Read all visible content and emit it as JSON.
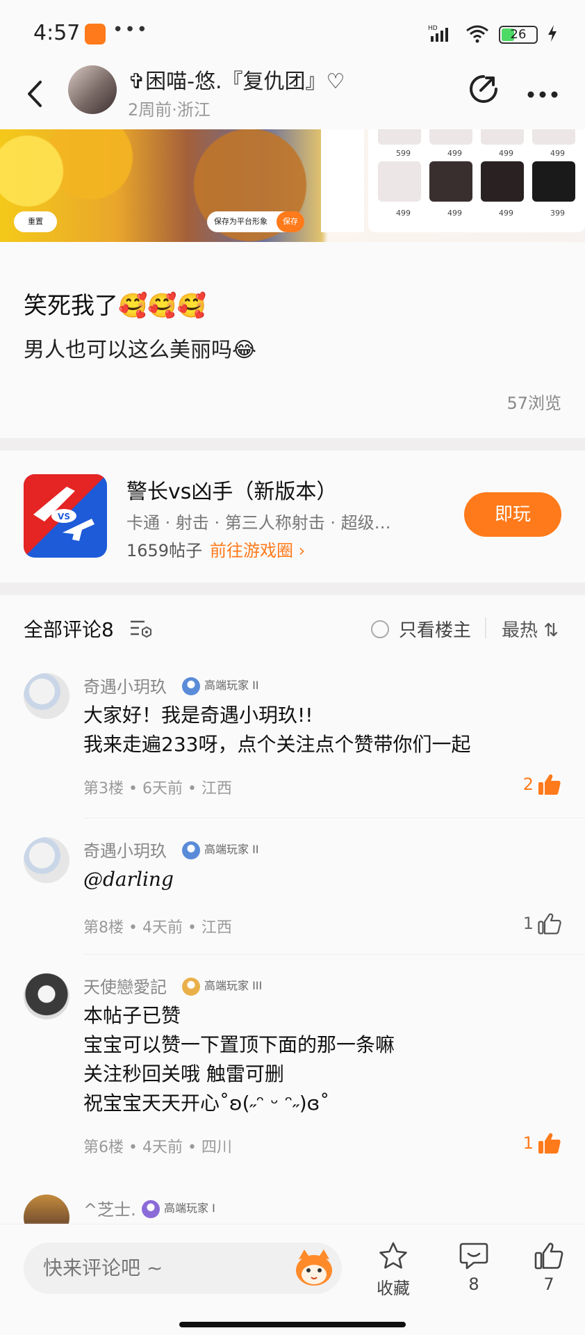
{
  "status": {
    "time": "4:57",
    "dots": "•••",
    "network": "HD",
    "battery": "26"
  },
  "header": {
    "author_name": "✞困喵-悠.『复仇团』♡",
    "meta": "2周前·浙江"
  },
  "image_panel": {
    "prices": [
      "599",
      "499",
      "499",
      "499",
      "499",
      "499",
      "499",
      "399"
    ],
    "reset_label": "重置",
    "save_label": "保存为平台形象",
    "save_btn": "保存"
  },
  "post": {
    "title": "笑死我了🥰🥰🥰",
    "body": "男人也可以这么美丽吗😂",
    "views": "57浏览"
  },
  "game": {
    "name": "警长vs凶手（新版本）",
    "tags": "卡通 · 射击 · 第三人称射击 · 超级…",
    "posts": "1659帖子",
    "link": "前往游戏圈 ›",
    "play": "即玩"
  },
  "comments_header": {
    "title": "全部评论8",
    "only_op": "只看楼主",
    "sort": "最热 ⇅"
  },
  "comments": [
    {
      "name": "奇遇小玥玖",
      "badge": "高端玩家 II",
      "lines": [
        "大家好！我是奇遇小玥玖!!",
        "我来走遍233呀，点个关注点个赞带你们一起"
      ],
      "meta": "第3楼 • 6天前 • 江西",
      "likes": "2",
      "liked": true
    },
    {
      "name": "奇遇小玥玖",
      "badge": "高端玩家 II",
      "lines": [
        "@darling"
      ],
      "meta": "第8楼 • 4天前 • 江西",
      "likes": "1",
      "liked": false
    },
    {
      "name": "天使戀愛記",
      "badge": "高端玩家 III",
      "lines": [
        "本帖子已赞",
        "宝宝可以赞一下置顶下面的那一条嘛",
        "关注秒回关哦 触雷可删",
        "祝宝宝天天开心˚ʚ(˶ᵔ ᵕ ᵔ˶)ɞ˚"
      ],
      "meta": "第6楼 • 4天前 • 四川",
      "likes": "1",
      "liked": true
    },
    {
      "name": "^芝士.",
      "badge": "高端玩家 I",
      "lines": [],
      "meta": "",
      "likes": "",
      "liked": false
    }
  ],
  "bottom_bar": {
    "placeholder": "快来评论吧 ~",
    "favorite": "收藏",
    "comments": "8",
    "likes": "7"
  },
  "colors": {
    "accent": "#ff7a1a",
    "text": "#222222",
    "muted": "#999999"
  },
  "icons": [
    "back-icon",
    "share-icon",
    "more-icon",
    "filter-icon",
    "thumbs-up-icon",
    "star-icon",
    "comment-icon",
    "mascot-icon"
  ]
}
